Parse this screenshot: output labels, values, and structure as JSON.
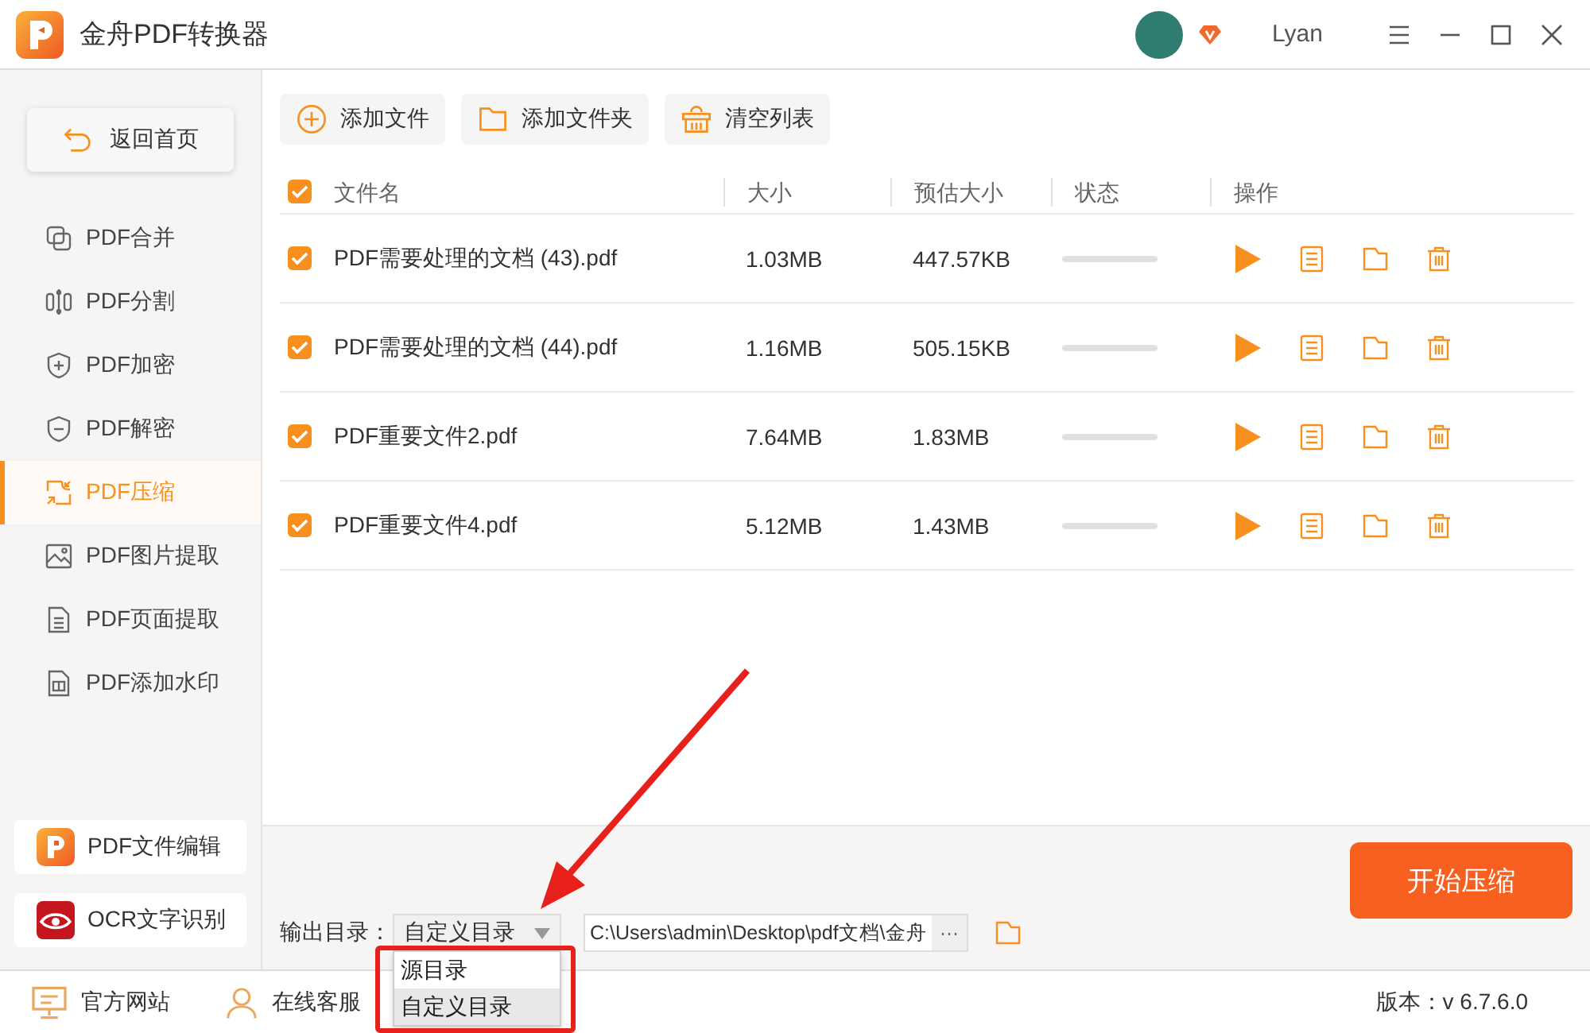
{
  "app": {
    "title": "金舟PDF转换器"
  },
  "user": {
    "name": "Lyan"
  },
  "sidebar": {
    "back_button": "返回首页",
    "items": [
      {
        "label": "PDF合并",
        "selected": false
      },
      {
        "label": "PDF分割",
        "selected": false
      },
      {
        "label": "PDF加密",
        "selected": false
      },
      {
        "label": "PDF解密",
        "selected": false
      },
      {
        "label": "PDF压缩",
        "selected": true
      },
      {
        "label": "PDF图片提取",
        "selected": false
      },
      {
        "label": "PDF页面提取",
        "selected": false
      },
      {
        "label": "PDF添加水印",
        "selected": false
      }
    ],
    "tools": [
      {
        "label": "PDF文件编辑"
      },
      {
        "label": "OCR文字识别"
      }
    ]
  },
  "toolbar": [
    {
      "label": "添加文件"
    },
    {
      "label": "添加文件夹"
    },
    {
      "label": "清空列表"
    }
  ],
  "table": {
    "all_checked": true,
    "columns": [
      "文件名",
      "大小",
      "预估大小",
      "状态",
      "操作"
    ],
    "rows": [
      {
        "checked": true,
        "name": "PDF需要处理的文档 (43).pdf",
        "size": "1.03MB",
        "estimated": "447.57KB"
      },
      {
        "checked": true,
        "name": "PDF需要处理的文档 (44).pdf",
        "size": "1.16MB",
        "estimated": "505.15KB"
      },
      {
        "checked": true,
        "name": "PDF重要文件2.pdf",
        "size": "7.64MB",
        "estimated": "1.83MB"
      },
      {
        "checked": true,
        "name": "PDF重要文件4.pdf",
        "size": "5.12MB",
        "estimated": "1.43MB"
      }
    ]
  },
  "output": {
    "label": "输出目录：",
    "mode": {
      "value": "自定义目录",
      "expanded": true,
      "options": [
        {
          "label": "源目录",
          "selected": false
        },
        {
          "label": "自定义目录",
          "selected": true
        }
      ]
    },
    "path": "C:\\Users\\admin\\Desktop\\pdf文档\\金舟",
    "browse": "···"
  },
  "start_button": "开始压缩",
  "footer": {
    "links": [
      {
        "label": "官方网站"
      },
      {
        "label": "在线客服"
      }
    ],
    "version": "版本：v 6.7.6.0"
  }
}
